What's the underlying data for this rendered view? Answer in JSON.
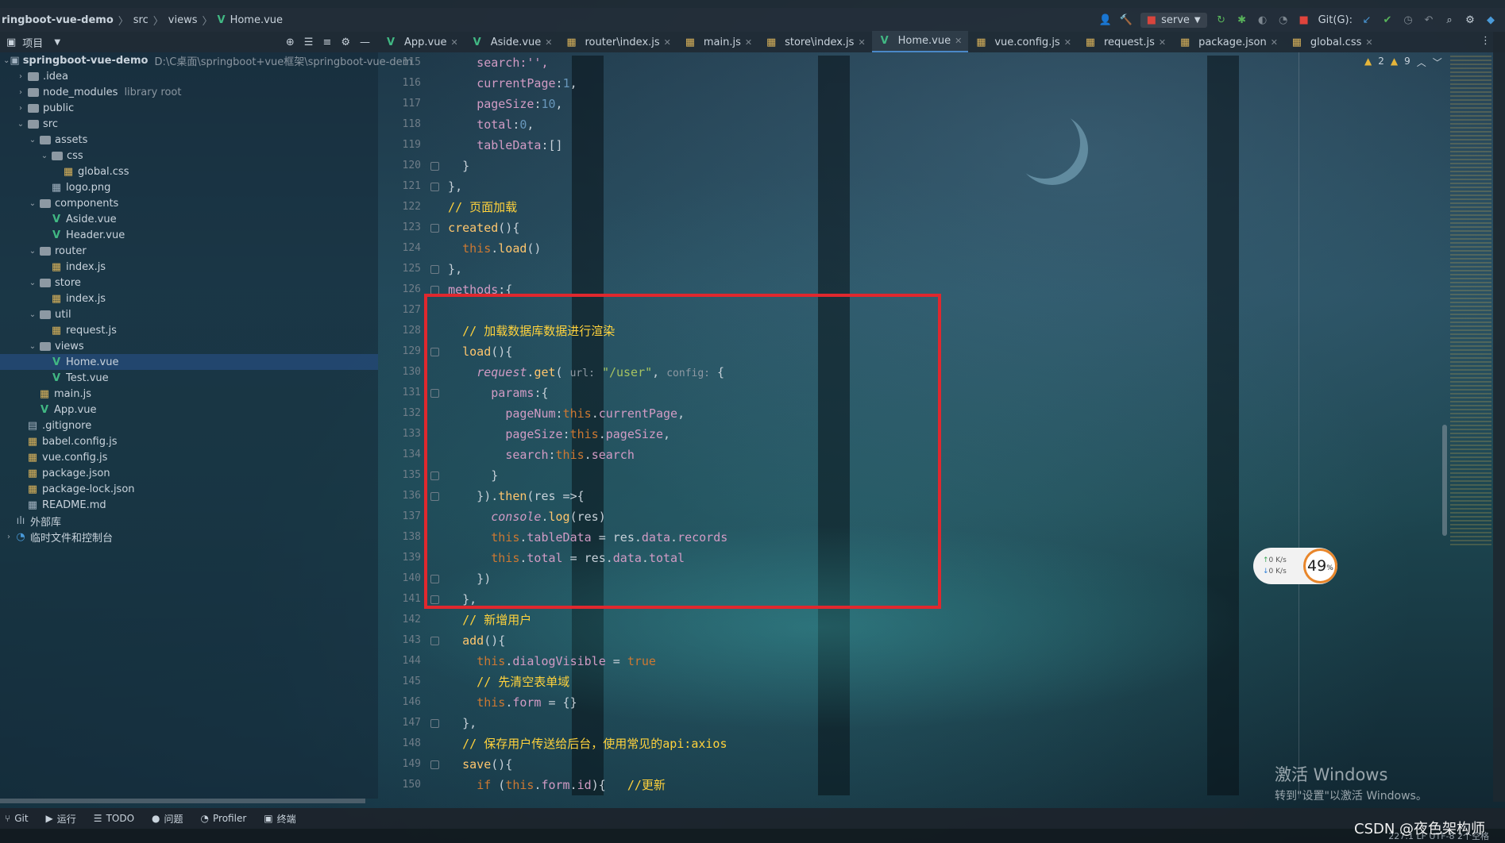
{
  "navbar": {
    "project": "ringboot-vue-demo",
    "crumbs": [
      "src",
      "views",
      "Home.vue"
    ],
    "run_config": "serve",
    "git_label": "Git(G):"
  },
  "project_panel": {
    "title": "项目",
    "tree": [
      {
        "label": "springboot-vue-demo",
        "hint": "D:\\C桌面\\springboot+vue框架\\springboot-vue-dem",
        "level": 0,
        "type": "root",
        "arrow": "open"
      },
      {
        "label": ".idea",
        "level": 1,
        "type": "folder",
        "arrow": "closed"
      },
      {
        "label": "node_modules",
        "hint": "library root",
        "level": 1,
        "type": "folder",
        "arrow": "closed"
      },
      {
        "label": "public",
        "level": 1,
        "type": "folder",
        "arrow": "closed"
      },
      {
        "label": "src",
        "level": 1,
        "type": "folder",
        "arrow": "open"
      },
      {
        "label": "assets",
        "level": 2,
        "type": "folder",
        "arrow": "open"
      },
      {
        "label": "css",
        "level": 3,
        "type": "folder",
        "arrow": "open"
      },
      {
        "label": "global.css",
        "level": 4,
        "type": "css"
      },
      {
        "label": "logo.png",
        "level": 3,
        "type": "png"
      },
      {
        "label": "components",
        "level": 2,
        "type": "folder",
        "arrow": "open"
      },
      {
        "label": "Aside.vue",
        "level": 3,
        "type": "vue"
      },
      {
        "label": "Header.vue",
        "level": 3,
        "type": "vue"
      },
      {
        "label": "router",
        "level": 2,
        "type": "folder",
        "arrow": "open"
      },
      {
        "label": "index.js",
        "level": 3,
        "type": "js"
      },
      {
        "label": "store",
        "level": 2,
        "type": "folder",
        "arrow": "open"
      },
      {
        "label": "index.js",
        "level": 3,
        "type": "js"
      },
      {
        "label": "util",
        "level": 2,
        "type": "folder",
        "arrow": "open"
      },
      {
        "label": "request.js",
        "level": 3,
        "type": "js"
      },
      {
        "label": "views",
        "level": 2,
        "type": "folder",
        "arrow": "open"
      },
      {
        "label": "Home.vue",
        "level": 3,
        "type": "vue",
        "selected": true
      },
      {
        "label": "Test.vue",
        "level": 3,
        "type": "vue"
      },
      {
        "label": "main.js",
        "level": 2,
        "type": "js"
      },
      {
        "label": "App.vue",
        "level": 2,
        "type": "vue"
      },
      {
        "label": ".gitignore",
        "level": 1,
        "type": "file"
      },
      {
        "label": "babel.config.js",
        "level": 1,
        "type": "js"
      },
      {
        "label": "vue.config.js",
        "level": 1,
        "type": "js"
      },
      {
        "label": "package.json",
        "level": 1,
        "type": "json"
      },
      {
        "label": "package-lock.json",
        "level": 1,
        "type": "json"
      },
      {
        "label": "README.md",
        "level": 1,
        "type": "md"
      },
      {
        "label": "外部库",
        "level": 0,
        "type": "lib"
      },
      {
        "label": "临时文件和控制台",
        "level": 0,
        "type": "scratch",
        "arrow": "closed"
      }
    ]
  },
  "tabs": [
    {
      "label": "App.vue",
      "type": "vue"
    },
    {
      "label": "Aside.vue",
      "type": "vue"
    },
    {
      "label": "router\\index.js",
      "type": "js"
    },
    {
      "label": "main.js",
      "type": "js"
    },
    {
      "label": "store\\index.js",
      "type": "js"
    },
    {
      "label": "Home.vue",
      "type": "vue",
      "active": true
    },
    {
      "label": "vue.config.js",
      "type": "js"
    },
    {
      "label": "request.js",
      "type": "js"
    },
    {
      "label": "package.json",
      "type": "json"
    },
    {
      "label": "global.css",
      "type": "css"
    }
  ],
  "inspections": {
    "warnings": "2",
    "weak_warnings": "9"
  },
  "editor": {
    "line_numbers": [
      "115",
      "116",
      "117",
      "118",
      "119",
      "120",
      "121",
      "122",
      "123",
      "124",
      "125",
      "126",
      "127",
      "128",
      "129",
      "130",
      "131",
      "132",
      "133",
      "134",
      "135",
      "136",
      "137",
      "138",
      "139",
      "140",
      "141",
      "142",
      "143",
      "144",
      "145",
      "146",
      "147",
      "148",
      "149",
      "150"
    ],
    "lines": [
      [
        {
          "t": "      search:'',",
          "c": "pr"
        }
      ],
      [
        {
          "t": "      ",
          "c": ""
        },
        {
          "t": "currentPage",
          "c": "pr"
        },
        {
          "t": ":",
          "c": ""
        },
        {
          "t": "1",
          "c": "num"
        },
        {
          "t": ",",
          "c": ""
        }
      ],
      [
        {
          "t": "      ",
          "c": ""
        },
        {
          "t": "pageSize",
          "c": "pr"
        },
        {
          "t": ":",
          "c": ""
        },
        {
          "t": "10",
          "c": "num"
        },
        {
          "t": ",",
          "c": ""
        }
      ],
      [
        {
          "t": "      ",
          "c": ""
        },
        {
          "t": "total",
          "c": "pr"
        },
        {
          "t": ":",
          "c": ""
        },
        {
          "t": "0",
          "c": "num"
        },
        {
          "t": ",",
          "c": ""
        }
      ],
      [
        {
          "t": "      ",
          "c": ""
        },
        {
          "t": "tableData",
          "c": "pr"
        },
        {
          "t": ":[]",
          "c": ""
        }
      ],
      [
        {
          "t": "    }",
          "c": ""
        }
      ],
      [
        {
          "t": "  },",
          "c": ""
        }
      ],
      [
        {
          "t": "  // 页面加载",
          "c": "cm"
        }
      ],
      [
        {
          "t": "  ",
          "c": ""
        },
        {
          "t": "created",
          "c": "fn"
        },
        {
          "t": "(){",
          "c": ""
        }
      ],
      [
        {
          "t": "    ",
          "c": ""
        },
        {
          "t": "this",
          "c": "k"
        },
        {
          "t": ".",
          "c": ""
        },
        {
          "t": "load",
          "c": "fn"
        },
        {
          "t": "()",
          "c": ""
        }
      ],
      [
        {
          "t": "  },",
          "c": ""
        }
      ],
      [
        {
          "t": "  ",
          "c": ""
        },
        {
          "t": "methods",
          "c": "pr"
        },
        {
          "t": ":{",
          "c": ""
        }
      ],
      [
        {
          "t": "",
          "c": ""
        }
      ],
      [
        {
          "t": "    // 加载数据库数据进行渲染",
          "c": "cm"
        }
      ],
      [
        {
          "t": "    ",
          "c": ""
        },
        {
          "t": "load",
          "c": "fn"
        },
        {
          "t": "(){",
          "c": ""
        }
      ],
      [
        {
          "t": "      ",
          "c": ""
        },
        {
          "t": "request",
          "c": "pr it"
        },
        {
          "t": ".",
          "c": ""
        },
        {
          "t": "get",
          "c": "fn"
        },
        {
          "t": "( ",
          "c": ""
        },
        {
          "t": "url:",
          "c": "ph"
        },
        {
          "t": " ",
          "c": ""
        },
        {
          "t": "\"/user\"",
          "c": "str"
        },
        {
          "t": ", ",
          "c": ""
        },
        {
          "t": "config:",
          "c": "ph"
        },
        {
          "t": " {",
          "c": ""
        }
      ],
      [
        {
          "t": "        ",
          "c": ""
        },
        {
          "t": "params",
          "c": "pr"
        },
        {
          "t": ":{",
          "c": ""
        }
      ],
      [
        {
          "t": "          ",
          "c": ""
        },
        {
          "t": "pageNum",
          "c": "pr"
        },
        {
          "t": ":",
          "c": ""
        },
        {
          "t": "this",
          "c": "k"
        },
        {
          "t": ".",
          "c": ""
        },
        {
          "t": "currentPage",
          "c": "pr"
        },
        {
          "t": ",",
          "c": ""
        }
      ],
      [
        {
          "t": "          ",
          "c": ""
        },
        {
          "t": "pageSize",
          "c": "pr"
        },
        {
          "t": ":",
          "c": ""
        },
        {
          "t": "this",
          "c": "k"
        },
        {
          "t": ".",
          "c": ""
        },
        {
          "t": "pageSize",
          "c": "pr"
        },
        {
          "t": ",",
          "c": ""
        }
      ],
      [
        {
          "t": "          ",
          "c": ""
        },
        {
          "t": "search",
          "c": "pr"
        },
        {
          "t": ":",
          "c": ""
        },
        {
          "t": "this",
          "c": "k"
        },
        {
          "t": ".",
          "c": ""
        },
        {
          "t": "search",
          "c": "pr"
        }
      ],
      [
        {
          "t": "        }",
          "c": ""
        }
      ],
      [
        {
          "t": "      }).",
          "c": ""
        },
        {
          "t": "then",
          "c": "fn"
        },
        {
          "t": "(res =>{",
          "c": ""
        }
      ],
      [
        {
          "t": "        ",
          "c": ""
        },
        {
          "t": "console",
          "c": "pr it"
        },
        {
          "t": ".",
          "c": ""
        },
        {
          "t": "log",
          "c": "fn"
        },
        {
          "t": "(res)",
          "c": ""
        }
      ],
      [
        {
          "t": "        ",
          "c": ""
        },
        {
          "t": "this",
          "c": "k"
        },
        {
          "t": ".",
          "c": ""
        },
        {
          "t": "tableData",
          "c": "pr"
        },
        {
          "t": " = res.",
          "c": ""
        },
        {
          "t": "data",
          "c": "pr"
        },
        {
          "t": ".",
          "c": ""
        },
        {
          "t": "records",
          "c": "pr"
        }
      ],
      [
        {
          "t": "        ",
          "c": ""
        },
        {
          "t": "this",
          "c": "k"
        },
        {
          "t": ".",
          "c": ""
        },
        {
          "t": "total",
          "c": "pr"
        },
        {
          "t": " = res.",
          "c": ""
        },
        {
          "t": "data",
          "c": "pr"
        },
        {
          "t": ".",
          "c": ""
        },
        {
          "t": "total",
          "c": "pr"
        }
      ],
      [
        {
          "t": "      })",
          "c": ""
        }
      ],
      [
        {
          "t": "    },",
          "c": ""
        }
      ],
      [
        {
          "t": "    // 新增用户",
          "c": "cm"
        }
      ],
      [
        {
          "t": "    ",
          "c": ""
        },
        {
          "t": "add",
          "c": "fn"
        },
        {
          "t": "(){",
          "c": ""
        }
      ],
      [
        {
          "t": "      ",
          "c": ""
        },
        {
          "t": "this",
          "c": "k"
        },
        {
          "t": ".",
          "c": ""
        },
        {
          "t": "dialogVisible",
          "c": "pr"
        },
        {
          "t": " = ",
          "c": ""
        },
        {
          "t": "true",
          "c": "k"
        }
      ],
      [
        {
          "t": "      // 先清空表单域",
          "c": "cm"
        }
      ],
      [
        {
          "t": "      ",
          "c": ""
        },
        {
          "t": "this",
          "c": "k"
        },
        {
          "t": ".",
          "c": ""
        },
        {
          "t": "form",
          "c": "pr"
        },
        {
          "t": " = {}",
          "c": ""
        }
      ],
      [
        {
          "t": "    },",
          "c": ""
        }
      ],
      [
        {
          "t": "    // 保存用户传送给后台，使用常见的api:axios",
          "c": "cm"
        }
      ],
      [
        {
          "t": "    ",
          "c": ""
        },
        {
          "t": "save",
          "c": "fn"
        },
        {
          "t": "(){",
          "c": ""
        }
      ],
      [
        {
          "t": "      ",
          "c": ""
        },
        {
          "t": "if",
          "c": "k"
        },
        {
          "t": " (",
          "c": ""
        },
        {
          "t": "this",
          "c": "k"
        },
        {
          "t": ".",
          "c": ""
        },
        {
          "t": "form",
          "c": "pr"
        },
        {
          "t": ".",
          "c": ""
        },
        {
          "t": "id",
          "c": "pr"
        },
        {
          "t": "){   ",
          "c": ""
        },
        {
          "t": "//更新",
          "c": "cm"
        }
      ]
    ]
  },
  "net_widget": {
    "up": "0",
    "down": "0",
    "unit": "K/s",
    "percent": "49",
    "percent_sign": "%"
  },
  "statusbar": [
    "Git",
    "运行",
    "TODO",
    "问题",
    "Profiler",
    "终端"
  ],
  "status_right": "227:1  LF  UTF-8  2个空格",
  "activation": {
    "line1": "激活 Windows",
    "line2": "转到\"设置\"以激活 Windows。"
  },
  "watermark": "CSDN @夜色架构师",
  "colors": {
    "highlight_box": "#e0282e",
    "comment": "#ffd23c",
    "keyword": "#cc7832"
  }
}
